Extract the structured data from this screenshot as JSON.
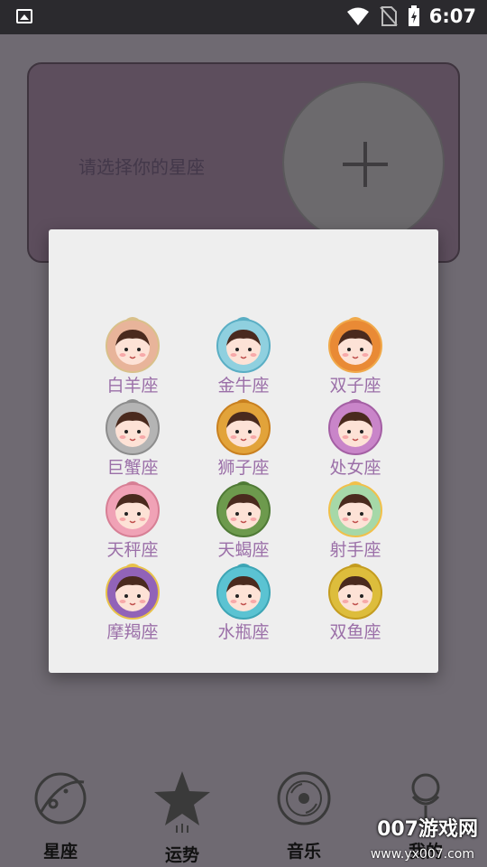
{
  "status_bar": {
    "time": "6:07"
  },
  "picker": {
    "prompt": "请选择你的星座"
  },
  "signs": [
    {
      "label": "白羊座",
      "color": "#e8b49a",
      "accent": "#d9c08a"
    },
    {
      "label": "金牛座",
      "color": "#8fd0df",
      "accent": "#5aaec4"
    },
    {
      "label": "双子座",
      "color": "#e98a35",
      "accent": "#f0a94a"
    },
    {
      "label": "巨蟹座",
      "color": "#b4b4b4",
      "accent": "#8c8c8c"
    },
    {
      "label": "狮子座",
      "color": "#e2a33a",
      "accent": "#c9801f"
    },
    {
      "label": "处女座",
      "color": "#c985c9",
      "accent": "#a45fa4"
    },
    {
      "label": "天秤座",
      "color": "#f0a2b6",
      "accent": "#d77f95"
    },
    {
      "label": "天蝎座",
      "color": "#6d9a4d",
      "accent": "#4f7a35"
    },
    {
      "label": "射手座",
      "color": "#a6d8a8",
      "accent": "#f1c04a"
    },
    {
      "label": "摩羯座",
      "color": "#9163b8",
      "accent": "#e8c24a"
    },
    {
      "label": "水瓶座",
      "color": "#5bc3d2",
      "accent": "#3da5b5"
    },
    {
      "label": "双鱼座",
      "color": "#ddbd3c",
      "accent": "#c49c1f"
    }
  ],
  "nav": {
    "items": [
      {
        "label": "星座",
        "icon": "planet-icon"
      },
      {
        "label": "运势",
        "icon": "star-icon"
      },
      {
        "label": "音乐",
        "icon": "disc-icon"
      },
      {
        "label": "我的",
        "icon": "user-icon"
      }
    ]
  },
  "watermark": {
    "text": "007游戏网",
    "url": "www.yx007.com"
  }
}
